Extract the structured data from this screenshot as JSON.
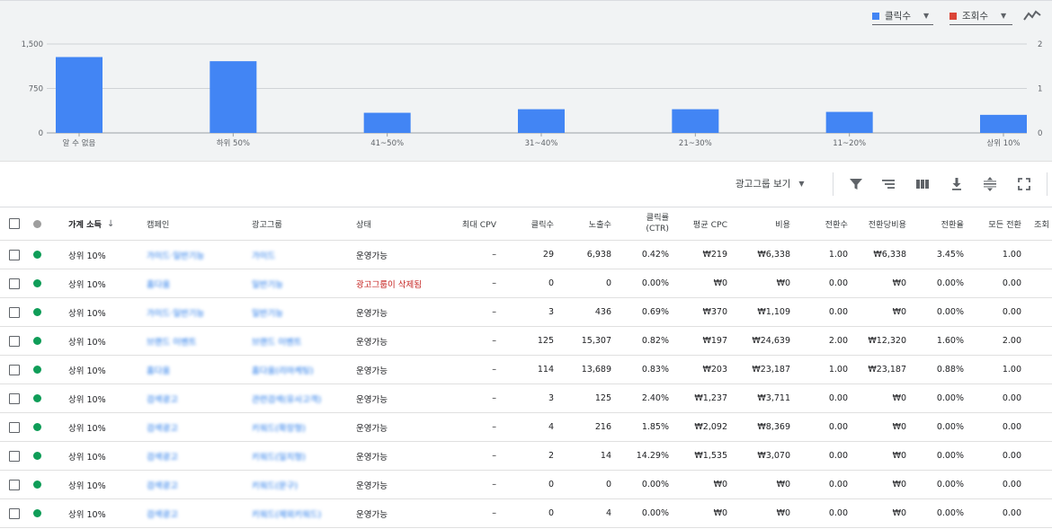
{
  "legend": {
    "clicks": {
      "label": "클릭수",
      "color": "#4285f4"
    },
    "impressions": {
      "label": "조회수",
      "color": "#db4437"
    }
  },
  "chart_data": {
    "type": "bar",
    "categories": [
      "알 수 없음",
      "하위 50%",
      "41~50%",
      "31~40%",
      "21~30%",
      "11~20%",
      "상위 10%"
    ],
    "series": [
      {
        "name": "클릭수",
        "values": [
          1280,
          1210,
          340,
          400,
          400,
          355,
          305
        ]
      }
    ],
    "y_ticks": [
      "1,500",
      "750",
      "0"
    ],
    "ylim": [
      0,
      1500
    ],
    "y2_ticks": [
      "2",
      "1",
      "0"
    ],
    "grid": true
  },
  "toolbar": {
    "view_label": "광고그룹 보기",
    "icons": [
      "filter-icon",
      "segment-icon",
      "columns-icon",
      "download-icon",
      "expand-rows-icon",
      "fullscreen-icon"
    ]
  },
  "table": {
    "headers": {
      "income": "가계 소득",
      "campaign": "캠페인",
      "adgroup": "광고그룹",
      "status": "상태",
      "max_cpv": "최대 CPV",
      "clicks": "클릭수",
      "impressions": "노출수",
      "ctr_line1": "클릭률",
      "ctr_line2": "(CTR)",
      "avg_cpc": "평균 CPC",
      "cost": "비용",
      "conversions": "전환수",
      "cost_per_conv": "전환당비용",
      "conv_rate": "전환율",
      "all_conv": "모든 전환",
      "views": "조회"
    },
    "rows": [
      {
        "income": "상위 10%",
        "campaign": "가이드·일반기능",
        "adgroup": "가이드",
        "status": "운영가능",
        "max_cpv": "–",
        "clicks": "29",
        "impressions": "6,938",
        "ctr": "0.42%",
        "avg_cpc": "₩219",
        "cost": "₩6,338",
        "conversions": "1.00",
        "cost_per_conv": "₩6,338",
        "conv_rate": "3.45%",
        "all_conv": "1.00"
      },
      {
        "income": "상위 10%",
        "campaign": "홈다움",
        "adgroup": "일반기능",
        "status": "광고그룹이 삭제됨",
        "max_cpv": "–",
        "clicks": "0",
        "impressions": "0",
        "ctr": "0.00%",
        "avg_cpc": "₩0",
        "cost": "₩0",
        "conversions": "0.00",
        "cost_per_conv": "₩0",
        "conv_rate": "0.00%",
        "all_conv": "0.00"
      },
      {
        "income": "상위 10%",
        "campaign": "가이드·일반기능",
        "adgroup": "일반기능",
        "status": "운영가능",
        "max_cpv": "–",
        "clicks": "3",
        "impressions": "436",
        "ctr": "0.69%",
        "avg_cpc": "₩370",
        "cost": "₩1,109",
        "conversions": "0.00",
        "cost_per_conv": "₩0",
        "conv_rate": "0.00%",
        "all_conv": "0.00"
      },
      {
        "income": "상위 10%",
        "campaign": "브랜드 이벤트",
        "adgroup": "브랜드 이벤트",
        "status": "운영가능",
        "max_cpv": "–",
        "clicks": "125",
        "impressions": "15,307",
        "ctr": "0.82%",
        "avg_cpc": "₩197",
        "cost": "₩24,639",
        "conversions": "2.00",
        "cost_per_conv": "₩12,320",
        "conv_rate": "1.60%",
        "all_conv": "2.00"
      },
      {
        "income": "상위 10%",
        "campaign": "홈다움",
        "adgroup": "홈다움(리마케팅)",
        "status": "운영가능",
        "max_cpv": "–",
        "clicks": "114",
        "impressions": "13,689",
        "ctr": "0.83%",
        "avg_cpc": "₩203",
        "cost": "₩23,187",
        "conversions": "1.00",
        "cost_per_conv": "₩23,187",
        "conv_rate": "0.88%",
        "all_conv": "1.00"
      },
      {
        "income": "상위 10%",
        "campaign": "검색광고",
        "adgroup": "관련검색(유사고객)",
        "status": "운영가능",
        "max_cpv": "–",
        "clicks": "3",
        "impressions": "125",
        "ctr": "2.40%",
        "avg_cpc": "₩1,237",
        "cost": "₩3,711",
        "conversions": "0.00",
        "cost_per_conv": "₩0",
        "conv_rate": "0.00%",
        "all_conv": "0.00"
      },
      {
        "income": "상위 10%",
        "campaign": "검색광고",
        "adgroup": "키워드(확장형)",
        "status": "운영가능",
        "max_cpv": "–",
        "clicks": "4",
        "impressions": "216",
        "ctr": "1.85%",
        "avg_cpc": "₩2,092",
        "cost": "₩8,369",
        "conversions": "0.00",
        "cost_per_conv": "₩0",
        "conv_rate": "0.00%",
        "all_conv": "0.00"
      },
      {
        "income": "상위 10%",
        "campaign": "검색광고",
        "adgroup": "키워드(일치형)",
        "status": "운영가능",
        "max_cpv": "–",
        "clicks": "2",
        "impressions": "14",
        "ctr": "14.29%",
        "avg_cpc": "₩1,535",
        "cost": "₩3,070",
        "conversions": "0.00",
        "cost_per_conv": "₩0",
        "conv_rate": "0.00%",
        "all_conv": "0.00"
      },
      {
        "income": "상위 10%",
        "campaign": "검색광고",
        "adgroup": "키워드(문구)",
        "status": "운영가능",
        "max_cpv": "–",
        "clicks": "0",
        "impressions": "0",
        "ctr": "0.00%",
        "avg_cpc": "₩0",
        "cost": "₩0",
        "conversions": "0.00",
        "cost_per_conv": "₩0",
        "conv_rate": "0.00%",
        "all_conv": "0.00"
      },
      {
        "income": "상위 10%",
        "campaign": "검색광고",
        "adgroup": "키워드(제외키워드)",
        "status": "운영가능",
        "max_cpv": "–",
        "clicks": "0",
        "impressions": "4",
        "ctr": "0.00%",
        "avg_cpc": "₩0",
        "cost": "₩0",
        "conversions": "0.00",
        "cost_per_conv": "₩0",
        "conv_rate": "0.00%",
        "all_conv": "0.00"
      }
    ]
  }
}
